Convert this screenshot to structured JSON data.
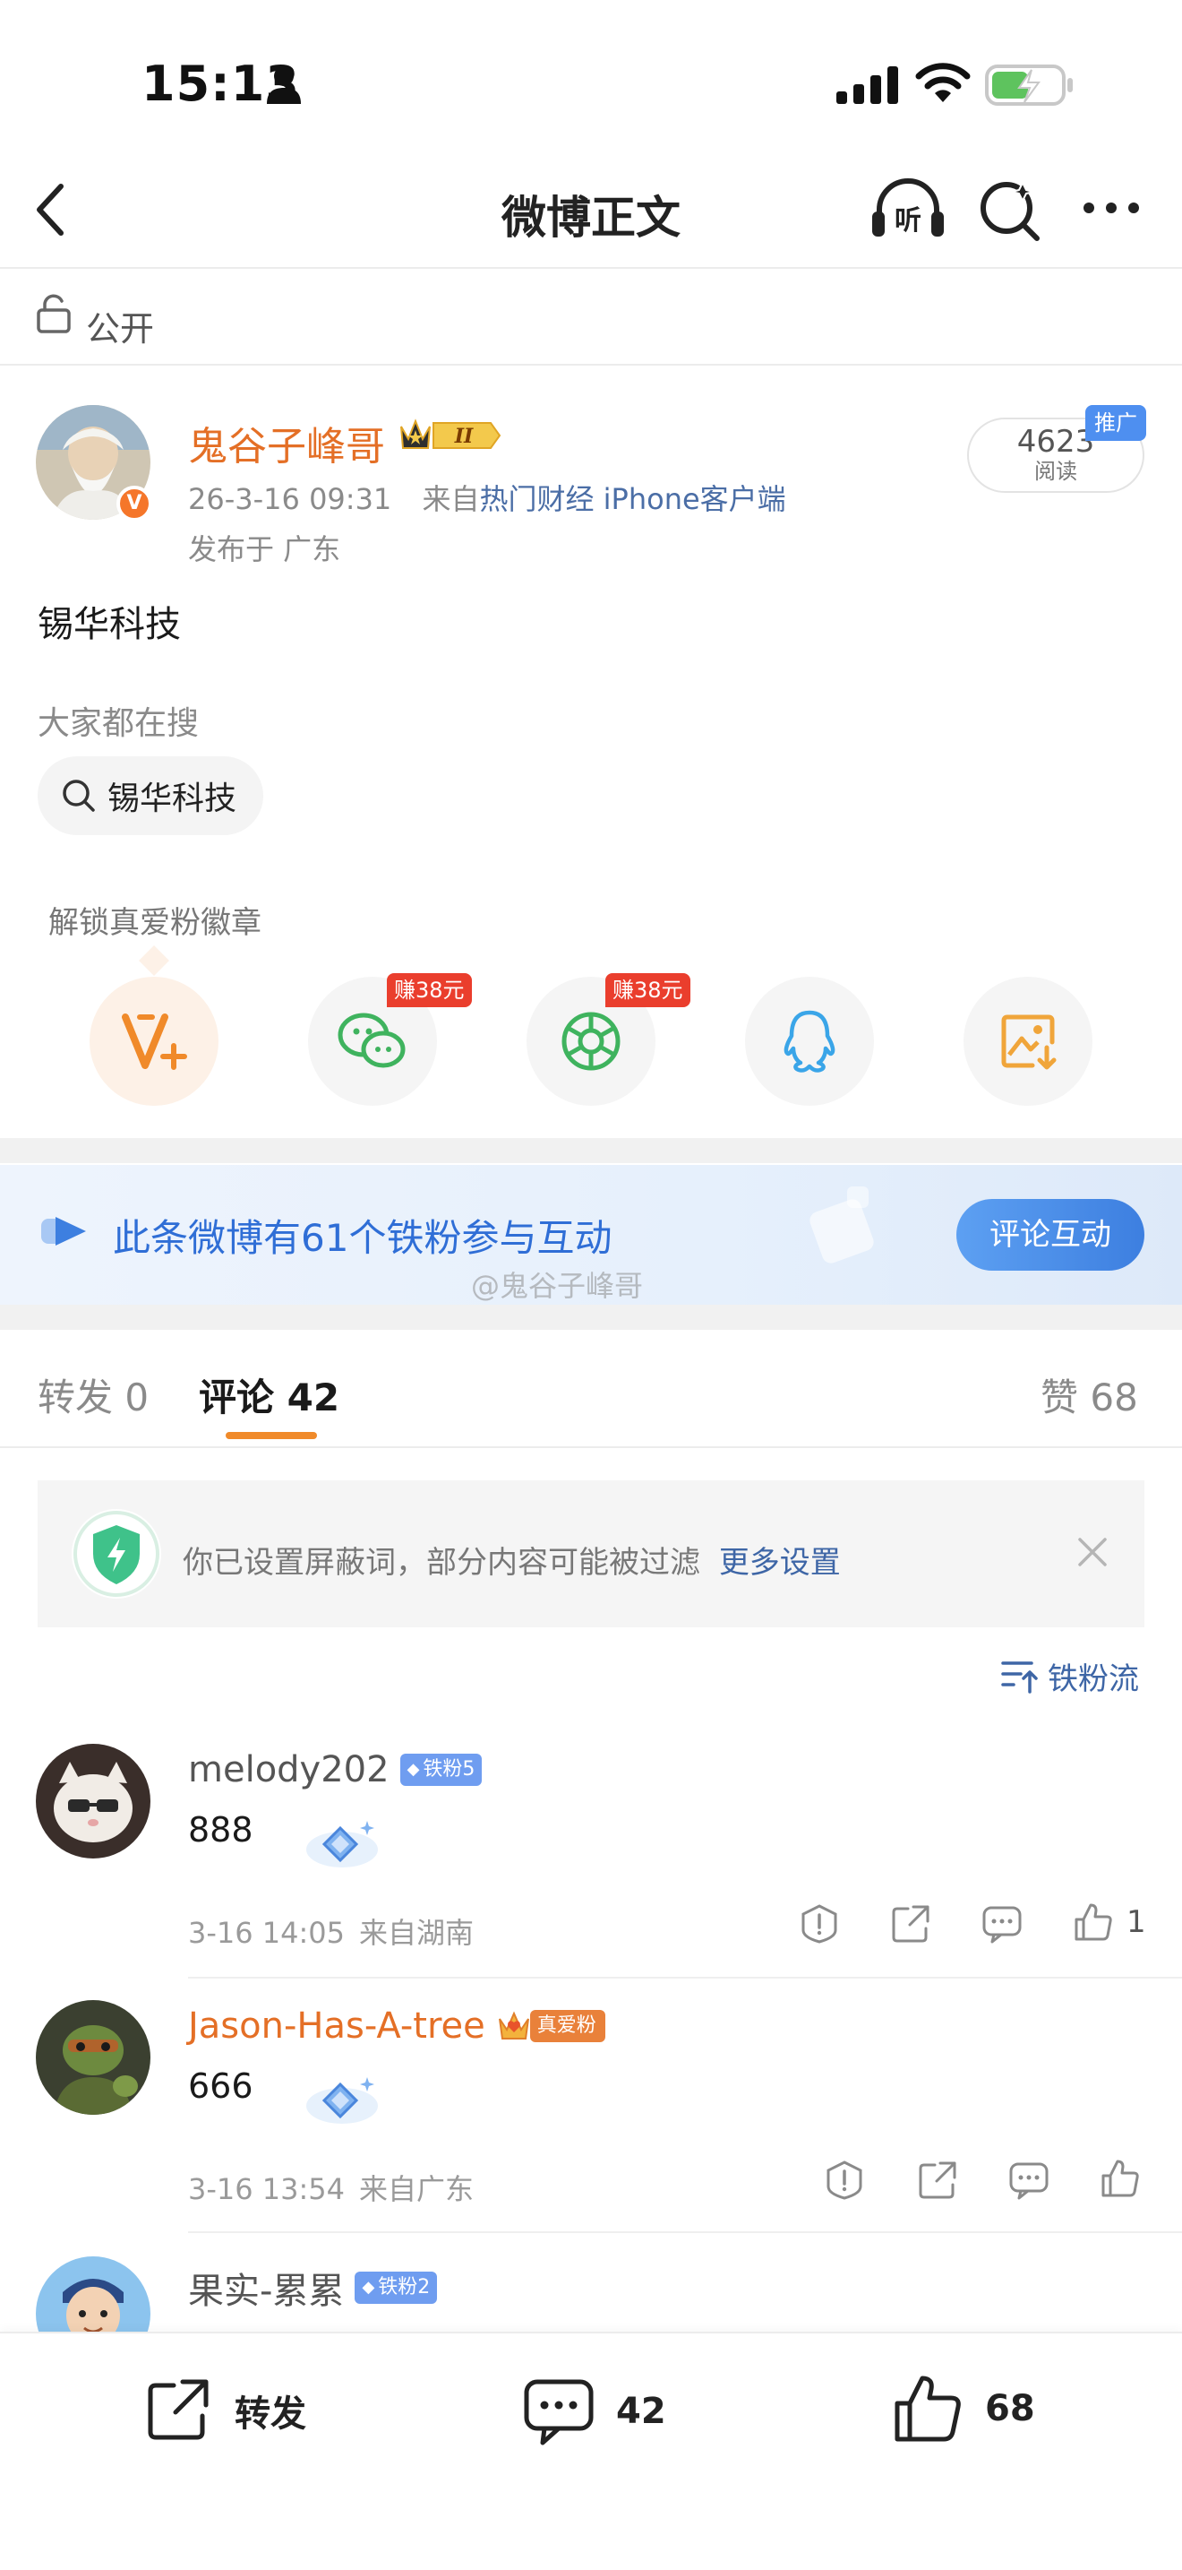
{
  "status_bar": {
    "time": "15:13"
  },
  "nav": {
    "title": "微博正文",
    "listen_label": "听"
  },
  "visibility": {
    "label": "公开"
  },
  "author": {
    "name": "鬼谷子峰哥",
    "verified_mark": "V",
    "level_badge": "II",
    "date": "26-3-16 09:31",
    "source_prefix": "来自",
    "source": "热门财经 iPhone客户端",
    "location": "发布于 广东"
  },
  "read_stats": {
    "count": "4623",
    "label": "阅读",
    "ad_tag": "推广"
  },
  "post": {
    "text": "锡华科技"
  },
  "search": {
    "section_label": "大家都在搜",
    "chip_text": "锡华科技"
  },
  "share": {
    "unlock_label": "解锁真爱粉徽章",
    "items": [
      {
        "icon": "v-plus-icon",
        "tag": ""
      },
      {
        "icon": "wechat-icon",
        "tag": "赚38元"
      },
      {
        "icon": "moments-icon",
        "tag": "赚38元"
      },
      {
        "icon": "qq-icon",
        "tag": ""
      },
      {
        "icon": "save-image-icon",
        "tag": ""
      }
    ]
  },
  "iron_fans": {
    "text": "此条微博有61个铁粉参与互动",
    "button": "评论互动"
  },
  "watermark": "@鬼谷子峰哥",
  "tabs": {
    "repost": "转发 0",
    "comments": "评论 42",
    "likes": "赞 68"
  },
  "filter_notice": {
    "text": "你已设置屏蔽词，部分内容可能被过滤",
    "link": "更多设置"
  },
  "sort": {
    "label": "铁粉流"
  },
  "comments": [
    {
      "name": "melody202",
      "badge": "铁粉5",
      "text": "888",
      "time": "3-16 14:05",
      "location": "来自湖南",
      "likes": "1"
    },
    {
      "name": "Jason-Has-A-tree",
      "badge": "真爱粉",
      "text": "666",
      "time": "3-16 13:54",
      "location": "来自广东",
      "likes": ""
    },
    {
      "name": "果实-累累",
      "badge": "铁粉2",
      "text": "",
      "time": "",
      "location": "",
      "likes": ""
    }
  ],
  "bottom_bar": {
    "repost": "转发",
    "comments": "42",
    "likes": "68"
  },
  "colors": {
    "accent_orange": "#e46f26",
    "link_blue": "#3e66a6",
    "fan_blue": "#2f6ed6"
  }
}
